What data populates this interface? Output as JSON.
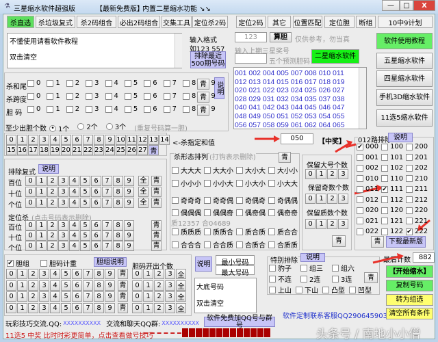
{
  "title": {
    "app": "三星缩水软件超强版",
    "edition": "【最新免费版】",
    "subtitle": "内置二星缩水功能 ↘↘"
  },
  "window_controls": {
    "minimize": "—",
    "maximize": "□",
    "close": "X"
  },
  "tabs": [
    "杀直选",
    "杀垃圾复式",
    "杀2码组合",
    "必出2码组合",
    "交集工具",
    "定位杀2码",
    "定位2码",
    "其它",
    "位置匹配",
    "定位胆",
    "断组",
    "10中9计划"
  ],
  "input_area": {
    "text1": "不懂使用请看软件教程",
    "text2": "双击清空",
    "format_label": "输入格式",
    "format_example": "如123 557",
    "exclude_button": "排除最近500期号码"
  },
  "digits": [
    "0",
    "1",
    "2",
    "3",
    "4",
    "5",
    "6",
    "7",
    "8",
    "9"
  ],
  "kill_rows": [
    {
      "label": "杀和尾",
      "clear": "青"
    },
    {
      "label": "杀跨度",
      "clear": "青"
    },
    {
      "label": "胆 码",
      "clear": "青"
    }
  ],
  "explain": "说明",
  "min_dan": {
    "label": "至少出胆个数",
    "options": [
      "1个",
      "2个",
      "3个"
    ],
    "selected": "1个",
    "note": "(重复号码算一胆)"
  },
  "sum_values": [
    "0",
    "1",
    "2",
    "3",
    "4",
    "5",
    "6",
    "7",
    "8",
    "9",
    "10",
    "11",
    "12",
    "13",
    "14",
    "15",
    "16",
    "17",
    "18",
    "19",
    "20",
    "21",
    "22",
    "23",
    "24",
    "25",
    "26",
    "27"
  ],
  "sum_clear": "青",
  "sum_kill": {
    "label": "<-杀指定和值",
    "value": "050",
    "prize": "【中奖】"
  },
  "exclude_multi": {
    "title": "排除复式",
    "explain": "说明",
    "positions": [
      "百位",
      "十位",
      "个位"
    ],
    "all": "全",
    "clear": "青"
  },
  "position_kill": {
    "title": "定位杀",
    "note": "(点击号码表示删除)",
    "positions": [
      "百位",
      "十位",
      "个位"
    ],
    "clear": "青"
  },
  "shape": {
    "title": "杀形态排列",
    "note": "(打钩表示删除)",
    "clear": "青",
    "groups": [
      [
        "大大大",
        "大大小",
        "大小大",
        "大小小"
      ],
      [
        "小小小",
        "小小大",
        "小大小",
        "小大大"
      ],
      [
        "奇奇奇",
        "奇奇偶",
        "奇偶奇",
        "奇偶偶"
      ],
      [
        "偶偶偶",
        "偶偶奇",
        "偶奇偶",
        "偶奇奇"
      ]
    ],
    "prime_note": "质12357 合04689",
    "prime_groups": [
      [
        "质质质",
        "质质合",
        "质合质",
        "质合合"
      ],
      [
        "合合合",
        "合合质",
        "合质合",
        "合质质"
      ]
    ]
  },
  "keep": {
    "big": "保留大号个数",
    "odd": "保留奇数个数",
    "prime": "保留质数个数",
    "counts": [
      "0",
      "1",
      "2",
      "3"
    ],
    "clear": "青"
  },
  "route012": {
    "title": "012路排除",
    "explain": "说明",
    "items": [
      [
        "000",
        "100",
        "200"
      ],
      [
        "001",
        "101",
        "201"
      ],
      [
        "002",
        "102",
        "202"
      ],
      [
        "010",
        "110",
        "210"
      ],
      [
        "011",
        "111",
        "211"
      ],
      [
        "012",
        "112",
        "212"
      ],
      [
        "020",
        "120",
        "220"
      ],
      [
        "021",
        "121",
        "221"
      ],
      [
        "022",
        "122",
        "222"
      ]
    ],
    "checked": [
      "000",
      "111",
      "222"
    ],
    "clear": "青",
    "download": "下载最新版"
  },
  "dan": {
    "code_input": "123",
    "calc_button": "算胆",
    "calc_note": "仅供参考，勿当真",
    "last_label": "输入上期三星奖号",
    "last_value": "",
    "predict_label": "五个预测胆码",
    "two_star_button": "二星缩水软件"
  },
  "numbers": "001 002 004 005 007 008 010 011\n012 013 014 015 016 017 018 019\n020 021 022 023 024 025 026 027\n028 029 031 032 034 035 037 038\n040 041 042 043 044 045 046 047\n048 049 050 051 052 053 054 055\n056 057 058 059 061 062 064 065",
  "side_buttons": [
    "软件使用教程",
    "五星缩水软件",
    "四星缩水软件",
    "手机3D缩水软件",
    "11选5缩水软件"
  ],
  "dan_group": {
    "checkbox": "胆组",
    "checked": true,
    "weight": "胆码计重",
    "explain": "胆组说明",
    "count_title": "胆码开出个数",
    "clear": "青",
    "all": "全",
    "counts": [
      "0",
      "1",
      "2",
      "3"
    ]
  },
  "minmax": {
    "explain": "说明",
    "min": "最小号码",
    "max": "最大号码",
    "text1": "大底号码",
    "text2": "双击清空",
    "qq_button": "软件免费加QQ号与群号"
  },
  "special": {
    "title": "特别排除",
    "explain": "说明",
    "items": [
      [
        "豹子",
        "组三",
        "组六"
      ],
      [
        "不连",
        "2连",
        "3连"
      ],
      [
        "上山",
        "下山",
        "凸型",
        "凹型"
      ]
    ],
    "clear": "青"
  },
  "contact": "软件定制联系客服QQ2906459031",
  "last_count": {
    "label": "最后计数",
    "value": "882"
  },
  "actions": {
    "start": "【开始缩水】",
    "copy": "复制号码",
    "to_group": "转为组选",
    "clear_all": "清空所有条件"
  },
  "footer": {
    "qq_label": "玩彩技巧交流.QQ:",
    "qq_value": "XXXXXXXXXX",
    "group_label": "交流和聊天QQ群:",
    "group_value": "XXXXXXXXXX",
    "promo": "11选5 中奖 比时时彩更简单，点击查看做号技巧"
  },
  "watermark": "头条号 / 南地小小僧"
}
